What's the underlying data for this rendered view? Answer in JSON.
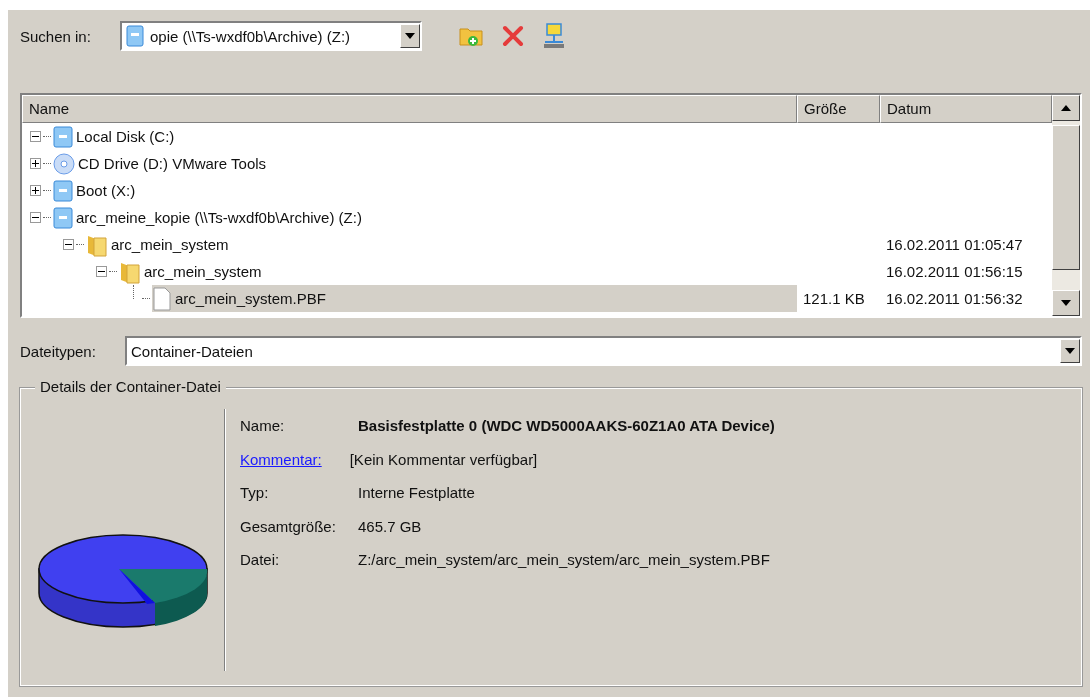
{
  "look_in": {
    "label": "Suchen in:",
    "value": "opie (\\\\Ts-wxdf0b\\Archive) (Z:)"
  },
  "columns": [
    "Name",
    "Größe",
    "Datum"
  ],
  "tree": [
    {
      "label": "Local Disk (C:)",
      "kind": "drive",
      "expanded": true,
      "selected": false
    },
    {
      "label": "CD Drive (D:) VMware Tools",
      "kind": "cd",
      "expanded": false,
      "selected": false
    },
    {
      "label": "Boot (X:)",
      "kind": "drive",
      "expanded": false,
      "selected": false
    },
    {
      "label": "arc_meine_kopie (\\\\Ts-wxdf0b\\Archive) (Z:)",
      "kind": "drive",
      "expanded": true,
      "selected": false,
      "children": [
        {
          "label": "arc_mein_system",
          "kind": "folder",
          "expanded": true,
          "selected": false,
          "date": "16.02.2011 01:05:47",
          "children": [
            {
              "label": "arc_mein_system",
              "kind": "folder",
              "expanded": true,
              "selected": false,
              "date": "16.02.2011 01:56:15",
              "children": [
                {
                  "label": "arc_mein_system.PBF",
                  "kind": "file",
                  "selected": true,
                  "size": "121.1 KB",
                  "date": "16.02.2011 01:56:32"
                }
              ]
            }
          ]
        }
      ]
    }
  ],
  "file_type": {
    "label": "Dateitypen:",
    "value": "Container-Dateien"
  },
  "details": {
    "title": "Details der Container-Datei",
    "rows": [
      {
        "label": "Name:",
        "value": "Basisfestplatte 0 (WDC WD5000AAKS-60Z1A0 ATA Device)",
        "kind": "bold"
      },
      {
        "label": "Kommentar:",
        "value": "[Kein Kommentar verfügbar]",
        "kind": "link"
      },
      {
        "label": "Typ:",
        "value": "Interne Festplatte",
        "kind": "plain"
      },
      {
        "label": "Gesamtgröße:",
        "value": "465.7 GB",
        "kind": "plain"
      },
      {
        "label": "Datei:",
        "value": "Z:/arc_mein_system/arc_mein_system/arc_mein_system.PBF",
        "kind": "plain"
      }
    ]
  }
}
